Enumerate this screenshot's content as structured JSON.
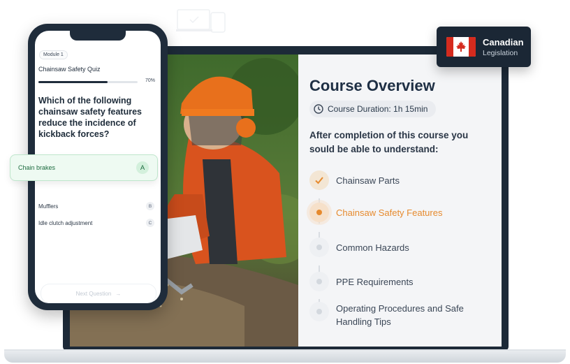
{
  "badge": {
    "title": "Canadian",
    "subtitle": "Legislation",
    "flag_icon": "canada-flag-icon"
  },
  "course": {
    "title": "Course Overview",
    "duration": "Course Duration: 1h 15min",
    "after_text": "After completion of this course you sould be able to understand:",
    "topics": [
      {
        "label": "Chainsaw Parts",
        "state": "done"
      },
      {
        "label": "Chainsaw Safety Features",
        "state": "active"
      },
      {
        "label": "Common Hazards",
        "state": "todo"
      },
      {
        "label": "PPE Requirements",
        "state": "todo"
      },
      {
        "label": "Operating Procedures and Safe Handling Tips",
        "state": "todo"
      }
    ],
    "accent_color": "#e68a2e"
  },
  "quiz": {
    "module": "Module 1",
    "title": "Chainsaw Safety Quiz",
    "progress_label": "70%",
    "progress_value": 0.7,
    "question": "Which of the following chainsaw safety features reduce the incidence of kickback forces?",
    "options": [
      {
        "label": "Chain brakes",
        "key": "A",
        "selected": true
      },
      {
        "label": "Mufflers",
        "key": "B"
      },
      {
        "label": "Idle clutch adjustment",
        "key": "C"
      }
    ],
    "next_label": "Next Question"
  }
}
